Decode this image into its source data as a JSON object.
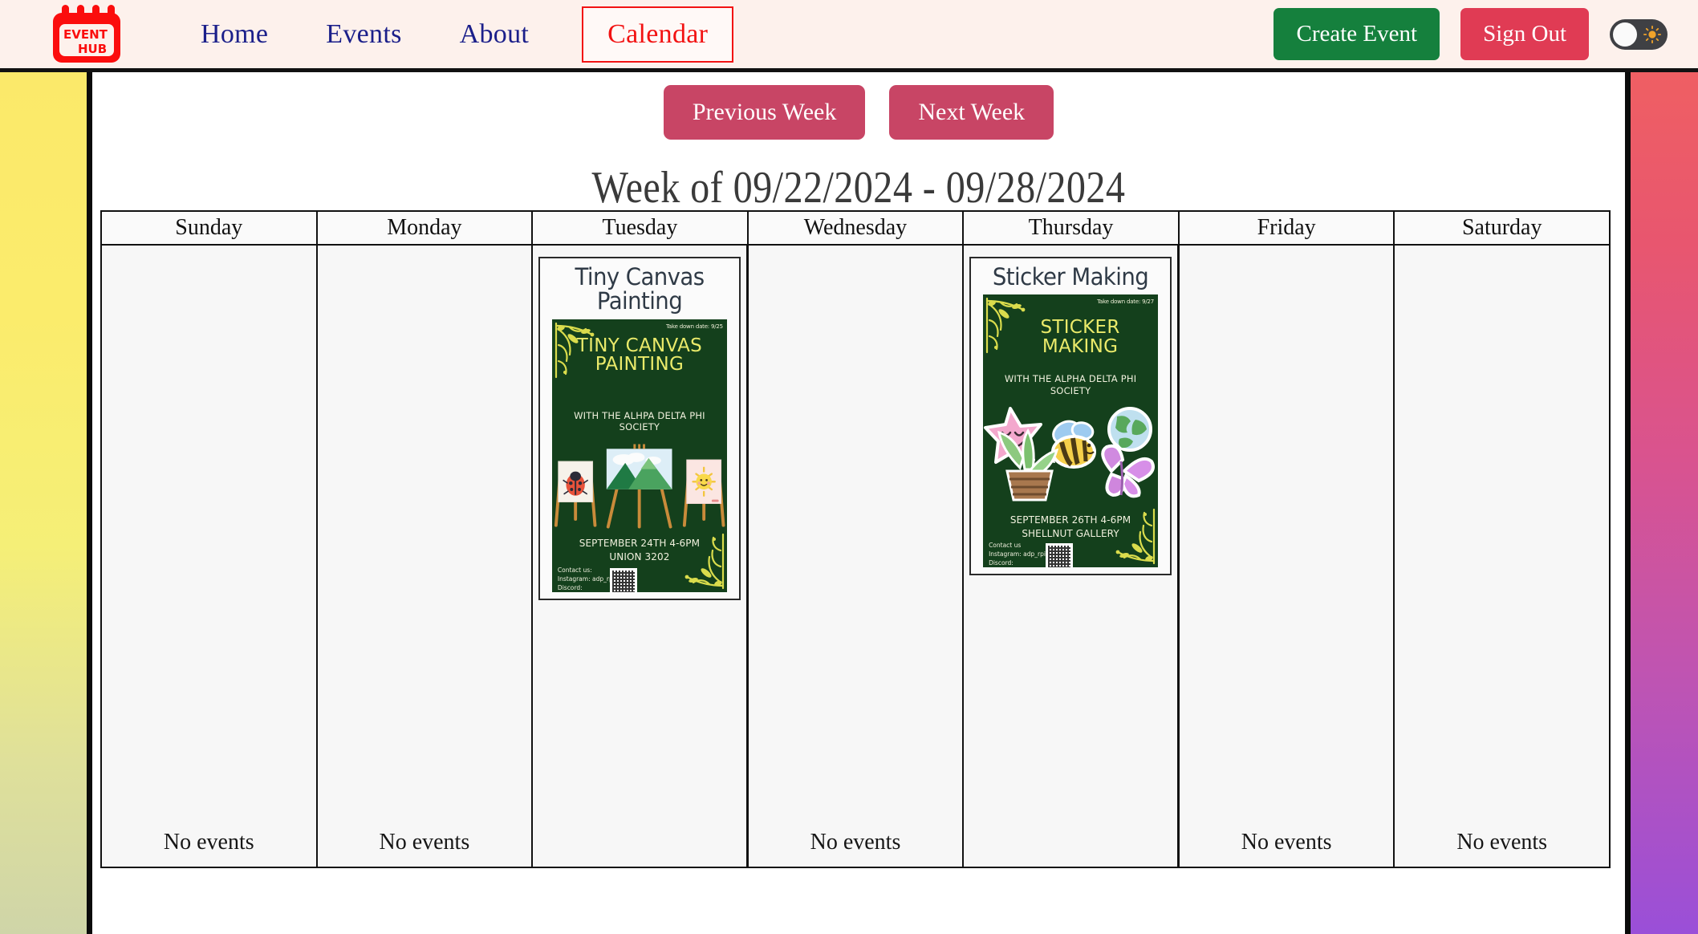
{
  "header": {
    "logo_text_top": "EVENT",
    "logo_text_bottom": "HUB",
    "nav": [
      {
        "label": "Home",
        "active": false
      },
      {
        "label": "Events",
        "active": false
      },
      {
        "label": "About",
        "active": false
      },
      {
        "label": "Calendar",
        "active": true
      }
    ],
    "create_event_label": "Create Event",
    "sign_out_label": "Sign Out",
    "theme_toggle_icon": "sun-icon"
  },
  "toolbar": {
    "previous_week_label": "Previous Week",
    "next_week_label": "Next Week"
  },
  "week_title": "Week of 09/22/2024 - 09/28/2024",
  "calendar": {
    "no_events_label": "No events",
    "days": [
      {
        "name": "Sunday",
        "has_event": false
      },
      {
        "name": "Monday",
        "has_event": false
      },
      {
        "name": "Tuesday",
        "has_event": true
      },
      {
        "name": "Wednesday",
        "has_event": false
      },
      {
        "name": "Thursday",
        "has_event": true
      },
      {
        "name": "Friday",
        "has_event": false
      },
      {
        "name": "Saturday",
        "has_event": false
      }
    ]
  },
  "events": [
    {
      "day": "Tuesday",
      "title": "Tiny Canvas Painting",
      "poster": {
        "takedown": "Take down date: 9/25",
        "headline": "TINY CANVAS PAINTING",
        "subtitle": "WITH THE ALHPA DELTA PHI SOCIETY",
        "when": "SEPTEMBER 24TH 4-6PM",
        "where": "UNION 3202",
        "contact_label": "Contact us:",
        "instagram": "Instagram: adp_rpi",
        "discord": "Discord:"
      }
    },
    {
      "day": "Thursday",
      "title": "Sticker Making",
      "poster": {
        "takedown": "Take down date: 9/27",
        "headline": "STICKER MAKING",
        "subtitle": "WITH THE ALPHA DELTA PHI SOCIETY",
        "when": "SEPTEMBER 26TH 4-6PM",
        "where": "SHELLNUT GALLERY",
        "contact_label": "Contact us",
        "instagram": "Instagram: adp_rpi",
        "discord": "Discord:"
      }
    }
  ],
  "colors": {
    "header_bg": "#fdf1ec",
    "nav_link": "#1b1f8a",
    "active_nav": "#f21212",
    "create_event": "#15803d",
    "sign_out": "#e03b54",
    "week_btn": "#c84565",
    "poster_bg": "#14401c",
    "poster_accent": "#eaea6a"
  }
}
